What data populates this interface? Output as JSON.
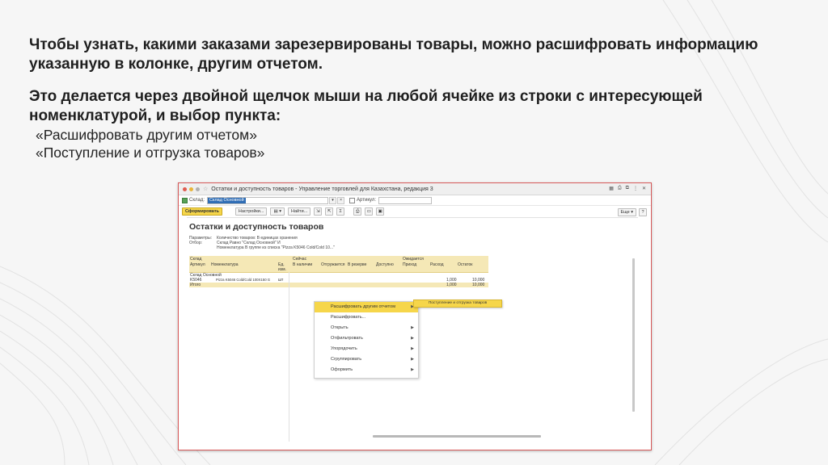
{
  "slide": {
    "paragraph1": "Чтобы узнать, какими заказами зарезервированы товары, можно расшифровать информацию указанную в колонке, другим отчетом.",
    "paragraph2": "Это делается через двойной щелчок мыши на любой ячейке из строки с интересующей номенклатурой, и выбор пункта:",
    "bullets": [
      "«Расшифровать другим отчетом»",
      "«Поступление и отгрузка товаров»"
    ]
  },
  "window": {
    "title": "Остатки и доступность товаров - Управление торговлей для Казахстана, редакция 3"
  },
  "filters": {
    "warehouse_label": "Склад:",
    "warehouse_value": "Склад Основной",
    "article_label": "Артикул:",
    "article_value": ""
  },
  "toolbar": {
    "generate": "Сформировать",
    "settings": "Настройки...",
    "find": "Найти...",
    "sum": "Σ",
    "more": "Еще",
    "help": "?"
  },
  "report": {
    "title": "Остатки и доступность товаров",
    "params_label": "Параметры:",
    "params_value": "Количество товаров: В единицах хранения",
    "filter_label": "Отбор:",
    "filter_value1": "Склад Равно \"Склад Основной\" И",
    "filter_value2": "Номенклатура В группе из списка \"Pizza K5046 Cold/Cold 10...\"",
    "headers": {
      "warehouse": "Склад",
      "article": "Артикул",
      "nomenclature": "Номенклатура",
      "unit": "Ед. изм.",
      "now": "Сейчас",
      "on_hand": "В наличии",
      "shipped": "Отгружается",
      "reserved": "В резерве",
      "available": "Доступно",
      "expected": "Ожидается",
      "receipt": "Приход",
      "expense": "Расход",
      "remainder": "Остаток"
    },
    "group_row": "Склад Основной",
    "data_row": {
      "article": "K5046",
      "name": "Pizza K5046 Cold/Cold 100X150 G",
      "unit": "шт",
      "expense": "1,000",
      "remainder": "10,000"
    },
    "total_row": {
      "label": "Итого",
      "expense": "1,000",
      "remainder": "10,000"
    }
  },
  "context_menu": {
    "items": [
      {
        "label": "Расшифровать другим отчетом",
        "submenu": true
      },
      {
        "label": "Расшифровать...",
        "submenu": false
      },
      {
        "label": "Открыть",
        "submenu": true
      },
      {
        "label": "Отфильтровать",
        "submenu": true
      },
      {
        "label": "Упорядочить",
        "submenu": true
      },
      {
        "label": "Сгруппировать",
        "submenu": true
      },
      {
        "label": "Оформить",
        "submenu": true
      }
    ],
    "submenu_item": "Поступление и отгрузка товаров",
    "highlight_color": "#f6d64a"
  }
}
